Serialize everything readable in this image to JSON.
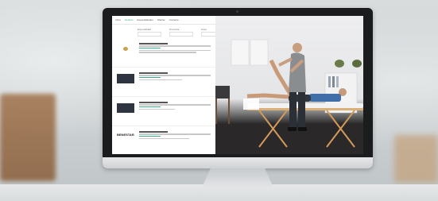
{
  "site": {
    "nav": [
      "Inicio",
      "Centros",
      "Especialidades",
      "Ofertas",
      "Contacto"
    ],
    "active_nav_index": 1,
    "filters": [
      "Especialidad",
      "Provincia",
      "Zona"
    ]
  },
  "listings": [
    {
      "thumb": "logo-light",
      "title_visible": false
    },
    {
      "thumb": "dark",
      "title_visible": false
    },
    {
      "thumb": "dark",
      "title_visible": false
    },
    {
      "thumb": "benestar",
      "logo_text": "BENESTAR"
    },
    {
      "thumb": "dark",
      "title_visible": false
    }
  ],
  "colors": {
    "accent": "#1fa37a",
    "monitor_bezel": "#1b1c1e",
    "therapist_shirt": "#8a8d90",
    "patient_shirt": "#3f6ea8"
  }
}
